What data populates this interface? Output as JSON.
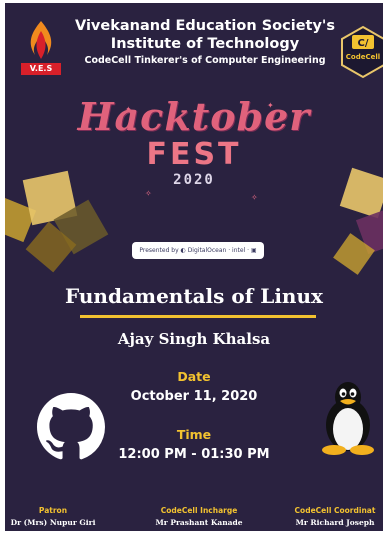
{
  "header": {
    "org_line1": "Vivekanand Education Society's",
    "org_line2": "Institute of Technology",
    "org_line3": "CodeCell Tinkerer's of Computer Engineering",
    "ves_logo_text": "V.E.S",
    "codecell_logo_text": "CodeCell"
  },
  "event": {
    "title_word1": "Hacktober",
    "title_word2": "FEST",
    "year": "2020",
    "sponsors": "Presented by  ◐ DigitalOcean · intel · ▣"
  },
  "session": {
    "title": "Fundamentals of Linux",
    "speaker": "Ajay Singh Khalsa",
    "date_label": "Date",
    "date_value": "October 11, 2020",
    "time_label": "Time",
    "time_value": "12:00 PM - 01:30 PM"
  },
  "footer": {
    "roles": [
      {
        "title": "Patron",
        "name": "Dr (Mrs) Nupur Giri"
      },
      {
        "title": "CodeCell Incharge",
        "name": "Mr Prashant Kanade"
      },
      {
        "title": "CodeCell Coordinat",
        "name": "Mr Richard Joseph"
      }
    ]
  },
  "icons": {
    "left": "github-logo-icon",
    "right": "linux-tux-icon"
  },
  "colors": {
    "background": "#2a2240",
    "accent_yellow": "#f2c230",
    "hacktober_pink": "#e0627c"
  }
}
